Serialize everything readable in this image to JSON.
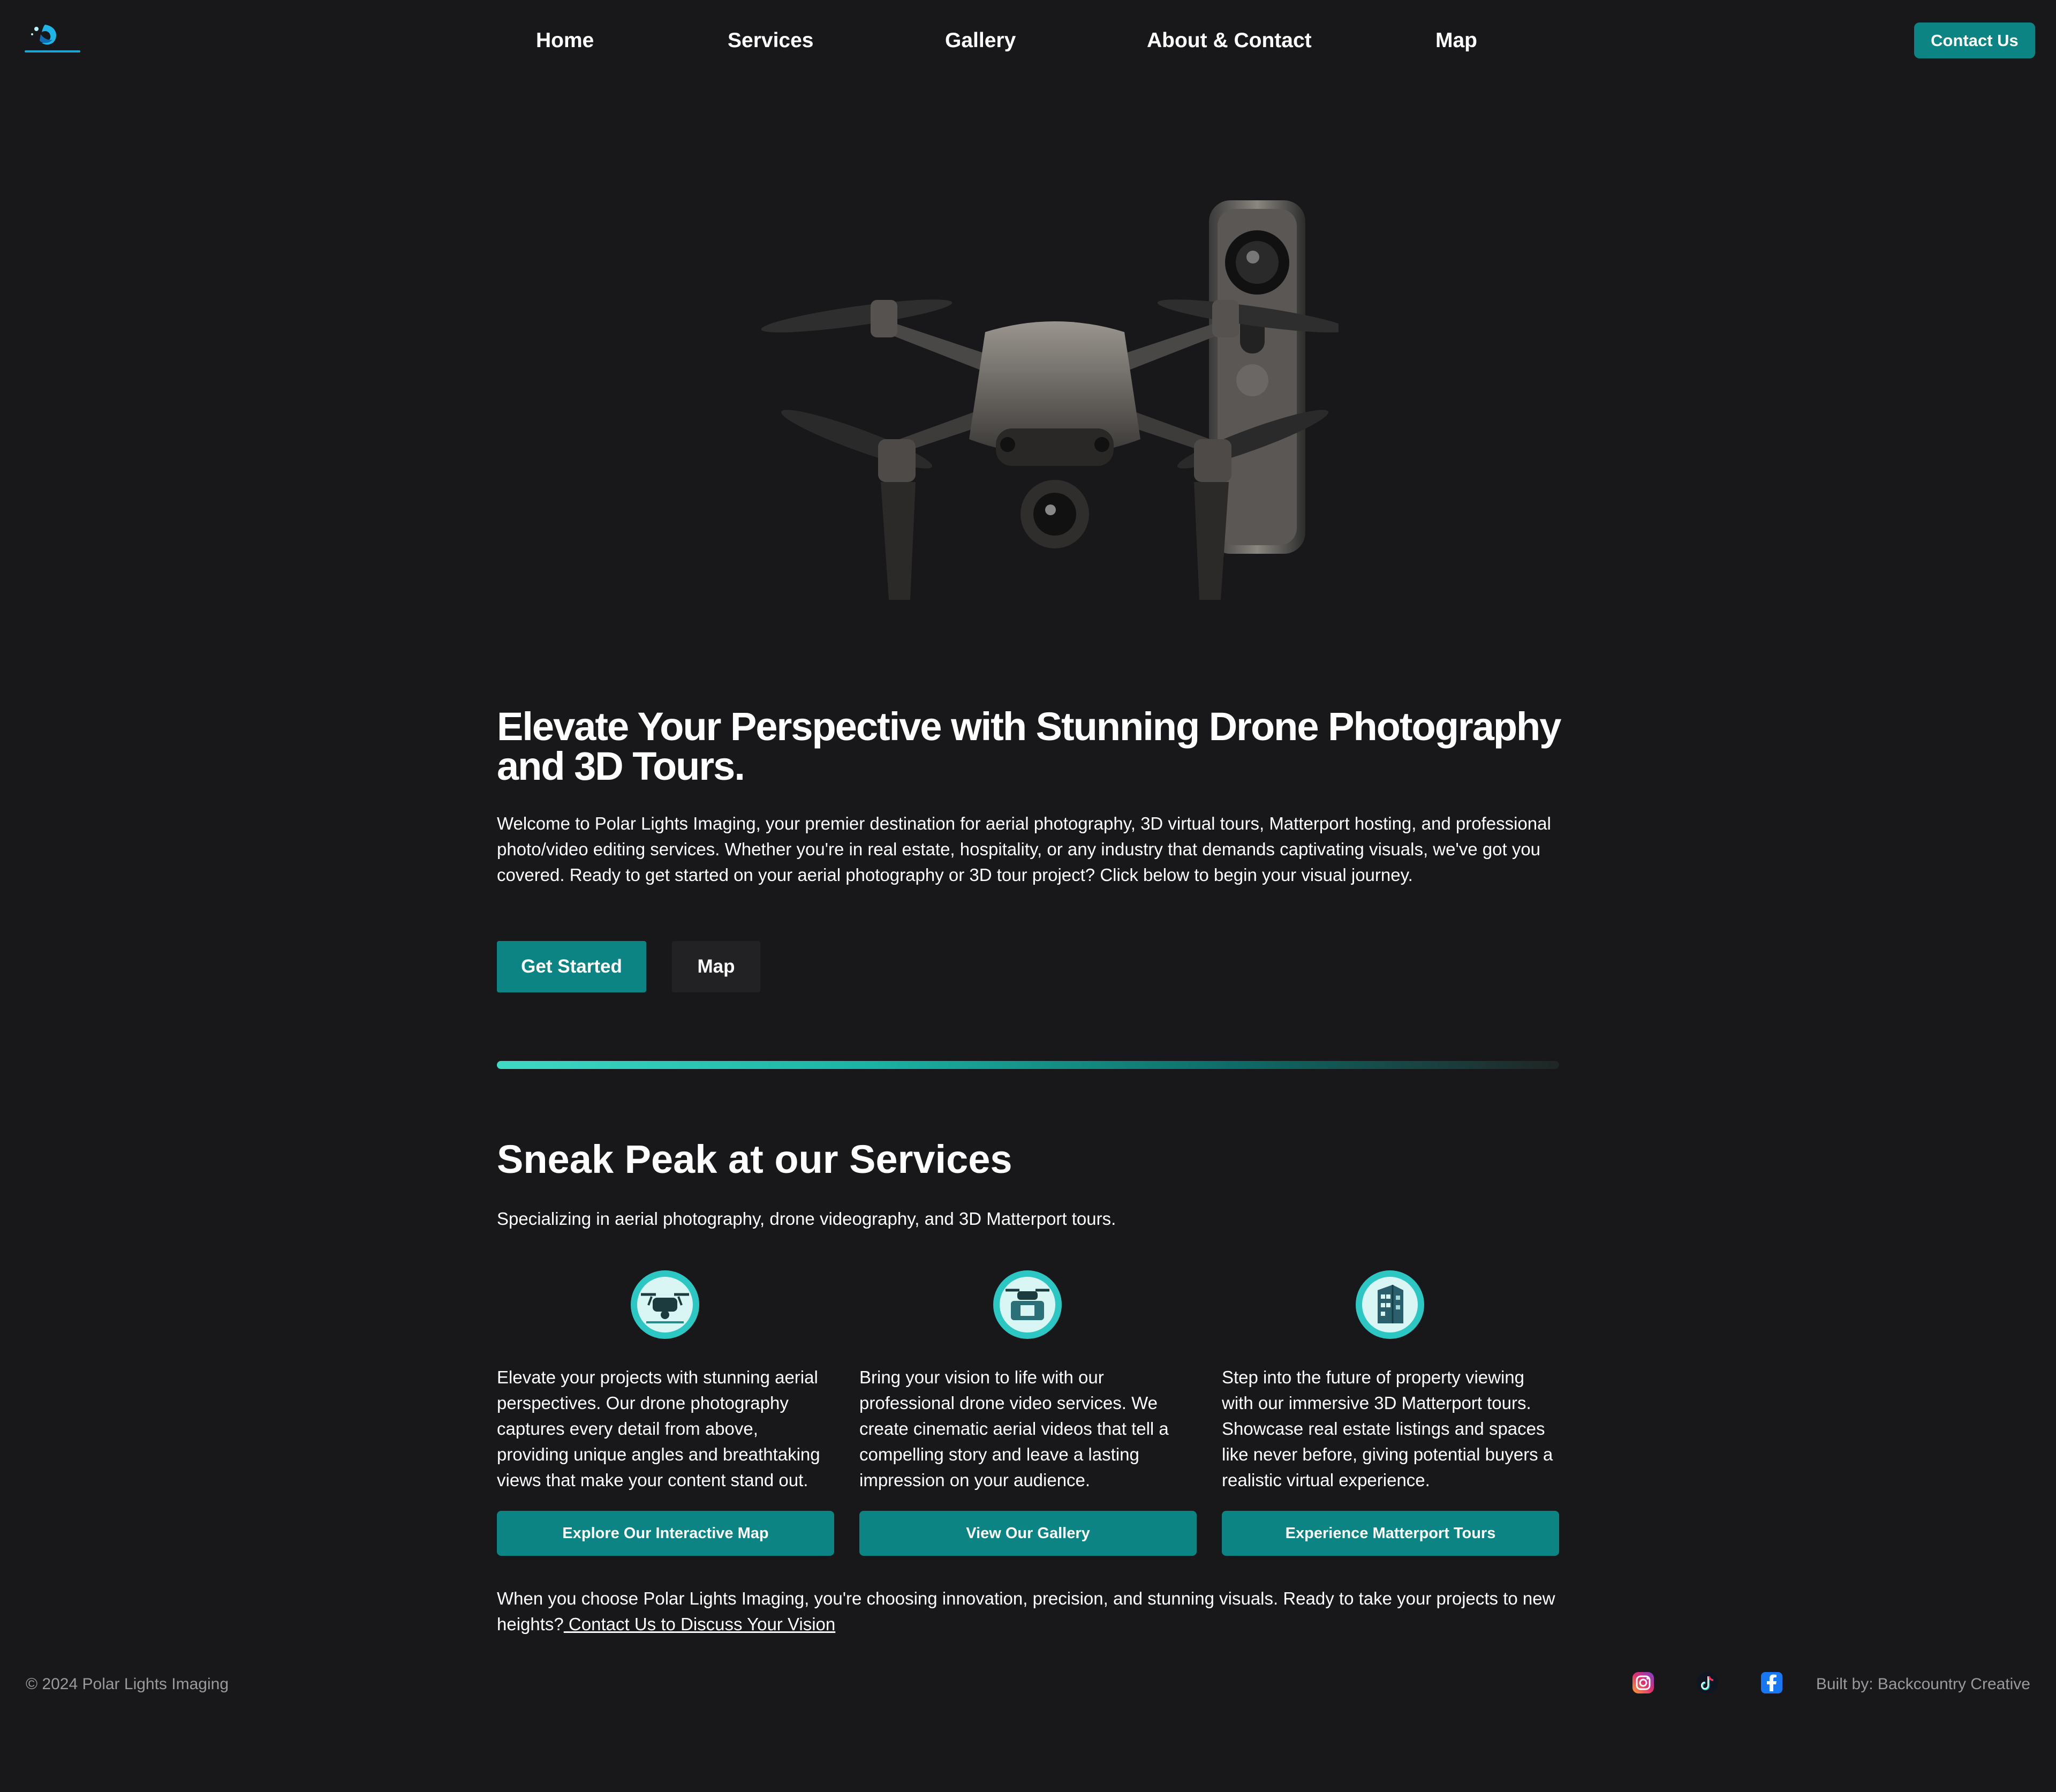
{
  "header": {
    "logo_icon": "polar-lights-logo-icon",
    "nav": [
      {
        "label": "Home"
      },
      {
        "label": "Services"
      },
      {
        "label": "Gallery"
      },
      {
        "label": "About & Contact"
      },
      {
        "label": "Map"
      }
    ],
    "contact_label": "Contact Us"
  },
  "hero": {
    "image_icon": "drone-and-360-camera-image",
    "title": "Elevate Your Perspective with Stunning Drone Photography and 3D Tours.",
    "text": "Welcome to Polar Lights Imaging, your premier destination for aerial photography, 3D virtual tours, Matterport hosting, and professional photo/video editing services. Whether you're in real estate, hospitality, or any industry that demands captivating visuals, we've got you covered. Ready to get started on your aerial photography or 3D tour project? Click below to begin your visual journey.",
    "primary_label": "Get Started",
    "secondary_label": "Map"
  },
  "services": {
    "title": "Sneak Peak at our Services",
    "subtitle": "Specializing in aerial photography, drone videography, and 3D Matterport tours.",
    "items": [
      {
        "icon": "drone-photography-icon",
        "text": "Elevate your projects with stunning aerial perspectives. Our drone photography captures every detail from above, providing unique angles and breathtaking views that make your content stand out.",
        "button": "Explore Our Interactive Map"
      },
      {
        "icon": "drone-video-icon",
        "text": "Bring your vision to life with our professional drone video services. We create cinematic aerial videos that tell a compelling story and leave a lasting impression on your audience.",
        "button": "View Our Gallery"
      },
      {
        "icon": "3d-building-icon",
        "text": "Step into the future of property viewing with our immersive 3D Matterport tours. Showcase real estate listings and spaces like never before, giving potential buyers a realistic virtual experience.",
        "button": "Experience Matterport Tours"
      }
    ],
    "closing_text": "When you choose Polar Lights Imaging, you're choosing innovation, precision, and stunning visuals. Ready to take your projects to new heights?",
    "closing_link": " Contact Us to Discuss Your Vision"
  },
  "footer": {
    "copyright": "© 2024 Polar Lights Imaging",
    "social": [
      "instagram-icon",
      "tiktok-icon",
      "facebook-icon"
    ],
    "built_by": "Built by: Backcountry Creative"
  },
  "colors": {
    "background": "#18181a",
    "accent": "#0b8483",
    "secondary_button": "#222224",
    "muted_text": "#9a9a9c"
  }
}
